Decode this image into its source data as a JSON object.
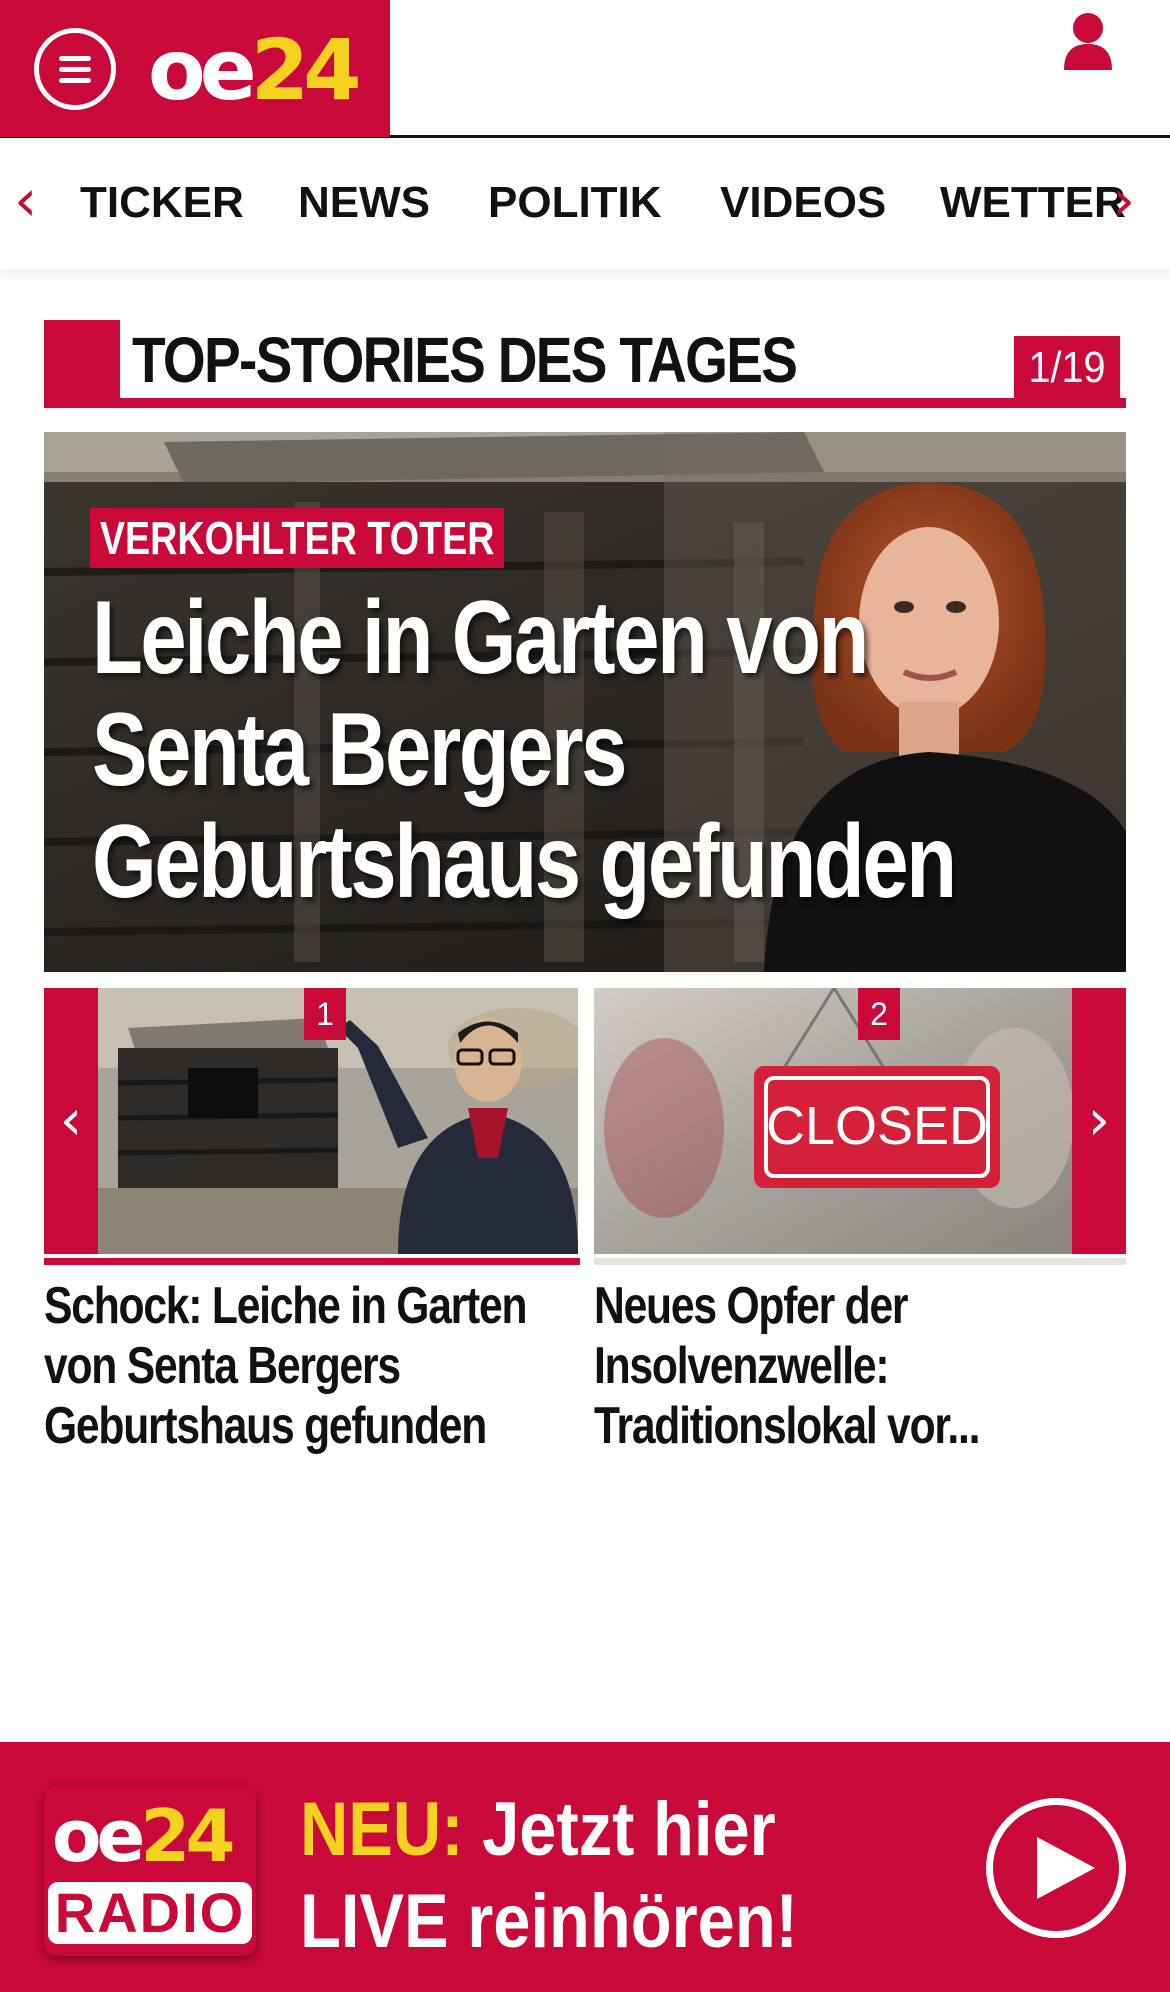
{
  "header": {
    "logo_main": "oe",
    "logo_accent": "24",
    "menu_icon": "hamburger-menu-icon",
    "user_icon": "user-icon"
  },
  "nav": {
    "items": [
      "TICKER",
      "NEWS",
      "POLITIK",
      "VIDEOS",
      "WETTER"
    ],
    "prev_arrow": "‹",
    "next_arrow": "›"
  },
  "section": {
    "title": "TOP-STORIES DES TAGES",
    "counter": "1/19"
  },
  "hero": {
    "tag": "VERKOHLTER TOTER",
    "headline": "Leiche in Garten von Senta Bergers Geburtshaus gefunden"
  },
  "carousel": {
    "items": [
      {
        "number": "1",
        "caption": "Schock: Leiche in Garten von Senta Bergers Geburtshaus gefunden"
      },
      {
        "number": "2",
        "caption": "Neues Opfer der Insolvenzwelle: Traditionslokal vor...",
        "sign_text": "CLOSED"
      }
    ],
    "prev_arrow": "‹",
    "next_arrow": "›"
  },
  "radio_banner": {
    "logo_main": "oe",
    "logo_accent": "24",
    "logo_sub": "RADIO",
    "highlight": "NEU:",
    "line1_rest": " Jetzt hier",
    "line2": "LIVE reinhören!"
  },
  "colors": {
    "brand_red": "#c8093a",
    "brand_yellow": "#f4d21f"
  }
}
